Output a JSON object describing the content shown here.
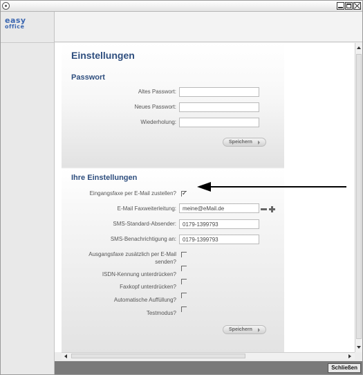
{
  "window": {
    "icons": {
      "app": "app-icon",
      "minimize": "minimize-icon",
      "maximize": "maximize-icon",
      "close": "close-icon"
    }
  },
  "sidebar": {
    "logo": {
      "line1": "easy",
      "line2": "office"
    }
  },
  "main": {
    "title": "Einstellungen",
    "password": {
      "heading": "Passwort",
      "old_label": "Altes Passwort:",
      "old_value": "",
      "new_label": "Neues Passwort:",
      "new_value": "",
      "repeat_label": "Wiederholung:",
      "repeat_value": "",
      "save_label": "Speichern"
    },
    "settings": {
      "heading": "Ihre Einstellungen",
      "email_delivery_label": "Eingangsfaxe per E-Mail zustellen?",
      "email_delivery_checked": true,
      "forward_label": "E-Mail Faxweiterleitung:",
      "forward_value": "meine@eMail.de",
      "sms_sender_label": "SMS-Standard-Absender:",
      "sms_sender_value": "0179-1399793",
      "sms_notify_label": "SMS-Benachrichtigung an:",
      "sms_notify_value": "0179-1399793",
      "outgoing_copy_label_1": "Ausgangsfaxe zusätzlich per E-Mail",
      "outgoing_copy_label_2": "senden?",
      "outgoing_copy_checked": false,
      "isdn_label": "ISDN-Kennung unterdrücken?",
      "isdn_checked": false,
      "faxhead_label": "Faxkopf unterdrücken?",
      "faxhead_checked": false,
      "autofill_label": "Automatische Auffüllung?",
      "autofill_checked": false,
      "testmode_label": "Testmodus?",
      "testmode_checked": false,
      "save_label": "Speichern"
    }
  },
  "footer": {
    "close_label": "Schließen"
  },
  "colors": {
    "heading": "#2e4e7e",
    "logo": "#3a66b0",
    "statusbar": "#7a7a7a"
  }
}
